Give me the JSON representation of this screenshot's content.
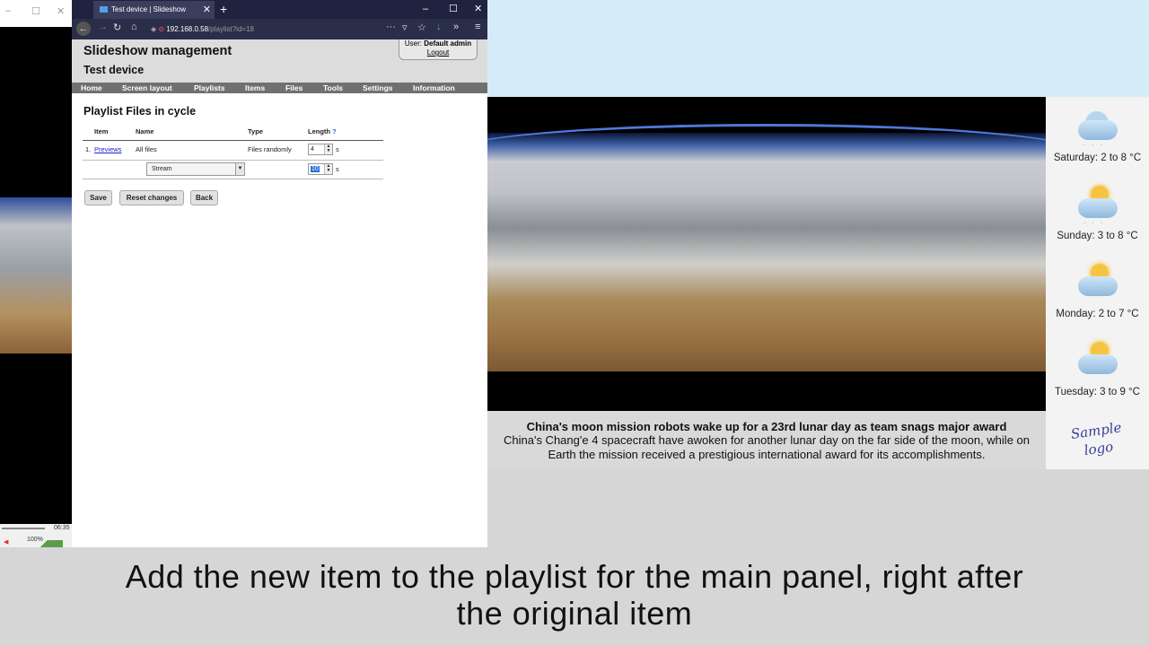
{
  "background_window": {
    "titlebar_controls": [
      "–",
      "☐",
      "✕"
    ],
    "status_time": "06:35",
    "status_zoom": "100%"
  },
  "browser": {
    "tab_title": "Test device | Slideshow",
    "url_host": "192.168.0.58",
    "url_path": "/playlist?id=18",
    "window_controls": [
      "–",
      "☐",
      "✕"
    ]
  },
  "page": {
    "app_title": "Slideshow management",
    "device_name": "Test device",
    "user_label": "User:",
    "user_name": "Default admin",
    "logout_label": "Logout",
    "menu": [
      "Home",
      "Screen layout",
      "Playlists",
      "Items",
      "Files",
      "Tools",
      "Settings",
      "Information"
    ],
    "heading": "Playlist Files in cycle",
    "table": {
      "headers": {
        "item": "Item",
        "name": "Name",
        "type": "Type",
        "length": "Length",
        "help": "?"
      },
      "row1": {
        "index": "1.",
        "item": "Previews",
        "name": "All files",
        "type": "Files randomly",
        "length": "4",
        "unit": "s"
      },
      "row2": {
        "select_value": "Stream",
        "length": "10",
        "unit": "s"
      }
    },
    "buttons": {
      "save": "Save",
      "reset": "Reset changes",
      "back": "Back"
    }
  },
  "display": {
    "weather": [
      {
        "label": "Saturday: 2 to 8 °C",
        "icon": "rain-cloud-icon"
      },
      {
        "label": "Sunday: 3 to 8 °C",
        "icon": "sun-rain-cloud-icon"
      },
      {
        "label": "Monday: 2 to 7 °C",
        "icon": "sun-cloud-icon"
      },
      {
        "label": "Tuesday: 3 to 9 °C",
        "icon": "sun-cloud-icon"
      }
    ],
    "news_title": "China's moon mission robots wake up for a 23rd lunar day as team snags major award",
    "news_body": "China's Chang'e 4 spacecraft have awoken for another lunar day on the far side of the moon, while on Earth the mission received a prestigious international award for its accomplishments.",
    "logo_line1": "Sample",
    "logo_line2": "logo"
  },
  "caption": {
    "line1": "Add the new item to the playlist for the main panel, right after",
    "line2": "the original item"
  }
}
